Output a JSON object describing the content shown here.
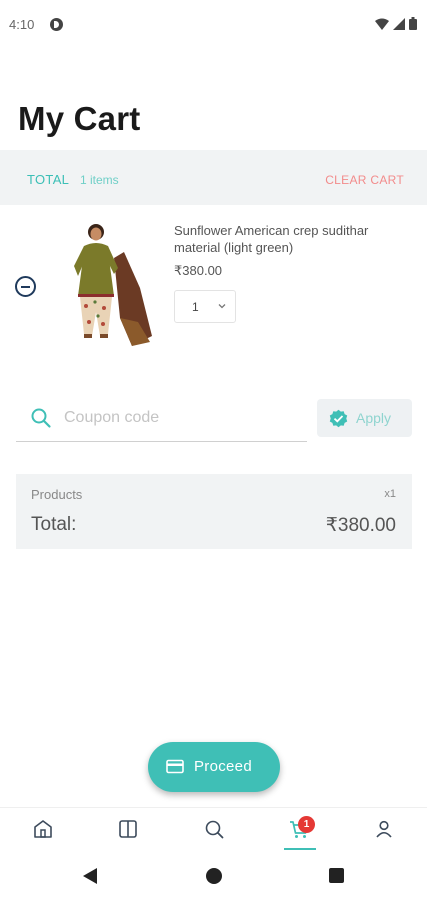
{
  "status_bar": {
    "time": "4:10"
  },
  "page": {
    "title": "My Cart"
  },
  "cart_header": {
    "total_label": "TOTAL",
    "items_count": "1 items",
    "clear_label": "CLEAR CART"
  },
  "cart_items": [
    {
      "name": "Sunflower American crep sudithar material (light green)",
      "price": "₹380.00",
      "quantity": "1"
    }
  ],
  "coupon": {
    "placeholder": "Coupon code",
    "apply_label": "Apply"
  },
  "summary": {
    "products_label": "Products",
    "products_count": "x1",
    "total_label": "Total:",
    "total_value": "₹380.00"
  },
  "proceed": {
    "label": "Proceed"
  },
  "bottom_nav": {
    "items": [
      "home-icon",
      "catalog-icon",
      "search-icon",
      "cart-icon",
      "account-icon"
    ],
    "active": "cart-icon",
    "cart_badge": "1"
  },
  "colors": {
    "accent": "#3fbfb6",
    "danger": "#f28b8b",
    "badge": "#e53935",
    "panel": "#f1f3f4"
  }
}
